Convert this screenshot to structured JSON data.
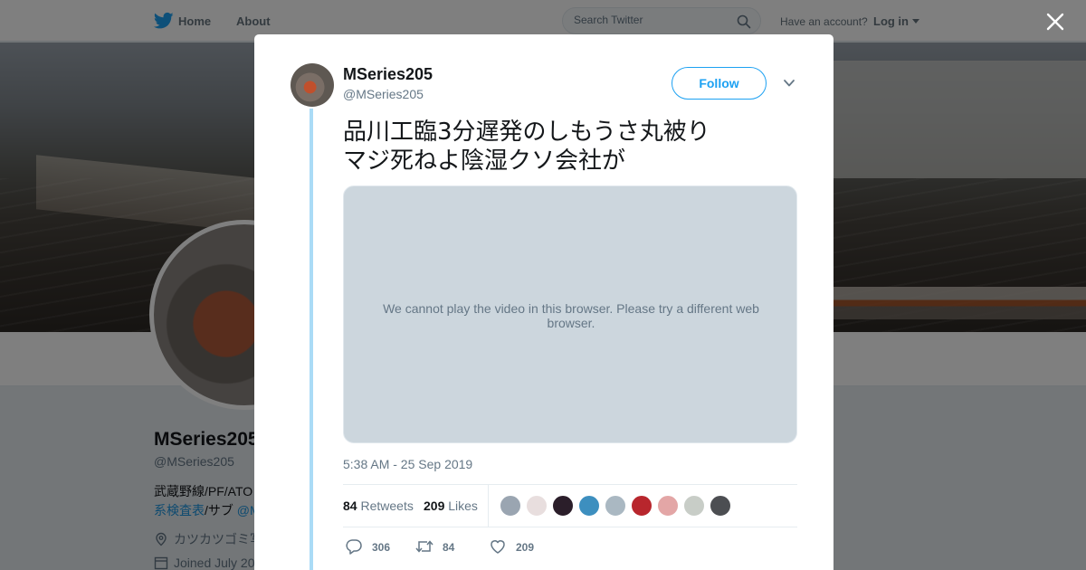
{
  "nav": {
    "home_label": "Home",
    "about_label": "About",
    "search_placeholder": "Search Twitter",
    "have_account": "Have an account?",
    "login_label": "Log in"
  },
  "profile": {
    "name": "MSeries205",
    "handle": "@MSeries205",
    "bio_line1": "武蔵野線/PF/ATO",
    "bio_line2_link": "系検査表",
    "bio_line2_sep": "/サブ ",
    "bio_line2_mention": "@M",
    "location": "カツカツゴミ写",
    "joined": "Joined July 20"
  },
  "tweet": {
    "author_name": "MSeries205",
    "author_handle": "@MSeries205",
    "follow_label": "Follow",
    "text_line1": "品川工臨3分遅発のしもうさ丸被り",
    "text_line2": "マジ死ねよ陰湿クソ会社が",
    "video_message": "We cannot play the video in this browser. Please try a different web browser.",
    "timestamp": "5:38 AM - 25 Sep 2019",
    "retweets_count": "84",
    "retweets_label": "Retweets",
    "likes_count": "209",
    "likes_label": "Likes",
    "reply_count": "306",
    "retweet_action_count": "84",
    "like_action_count": "209"
  },
  "likers": [
    {
      "icon": "avatar-gray-circle",
      "color": "#9aa5b1"
    },
    {
      "icon": "avatar-pale-pink",
      "color": "#e8dede"
    },
    {
      "icon": "avatar-dark-figure",
      "color": "#2b1e2a"
    },
    {
      "icon": "avatar-anime-character",
      "color": "#3d8fbf"
    },
    {
      "icon": "avatar-default-silhouette",
      "color": "#aab8c2"
    },
    {
      "icon": "avatar-red-logo",
      "color": "#b8262d"
    },
    {
      "icon": "avatar-pink-pattern",
      "color": "#e3a6a6"
    },
    {
      "icon": "avatar-light-gray",
      "color": "#c8cdc7"
    },
    {
      "icon": "avatar-train-photo",
      "color": "#4c4e52"
    }
  ],
  "colors": {
    "accent": "#1da1f2",
    "thread_line": "#aadbf6",
    "muted_text": "#657786"
  }
}
